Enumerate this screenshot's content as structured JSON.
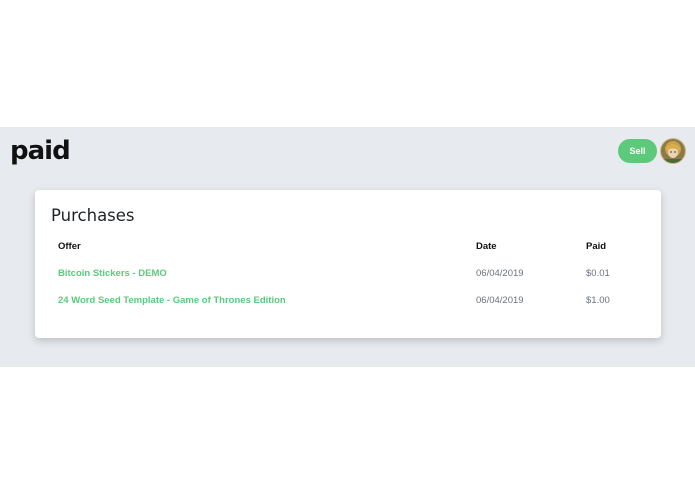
{
  "header": {
    "logo_text": "paid",
    "sell_label": "Sell",
    "avatar_icon": "user-avatar-icon"
  },
  "purchases": {
    "title": "Purchases",
    "columns": {
      "offer": "Offer",
      "date": "Date",
      "paid": "Paid"
    },
    "rows": [
      {
        "offer": "Bitcoin Stickers - DEMO",
        "date": "06/04/2019",
        "paid": "$0.01"
      },
      {
        "offer": "24 Word Seed Template - Game of Thrones Edition",
        "date": "06/04/2019",
        "paid": "$1.00"
      }
    ]
  },
  "colors": {
    "accent": "#5cc97b",
    "background_band": "#e7eaee",
    "card": "#ffffff"
  }
}
